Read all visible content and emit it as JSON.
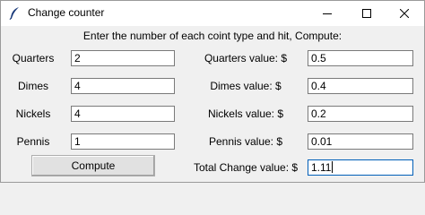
{
  "window": {
    "title": "Change counter",
    "icon": "feather-icon"
  },
  "instruction": "Enter the number of each coint type and hit, Compute:",
  "inputs": [
    {
      "label": "Quarters",
      "value": "2"
    },
    {
      "label": "Dimes",
      "value": "4"
    },
    {
      "label": "Nickels",
      "value": "4"
    },
    {
      "label": "Pennis",
      "value": "1"
    }
  ],
  "results": [
    {
      "label": "Quarters value: $",
      "value": "0.5"
    },
    {
      "label": "Dimes value: $",
      "value": "0.4"
    },
    {
      "label": "Nickels value: $",
      "value": "0.2"
    },
    {
      "label": "Pennis value: $",
      "value": "0.01"
    }
  ],
  "total": {
    "label": "Total Change value: $",
    "value": "1.11"
  },
  "compute_label": "Compute"
}
